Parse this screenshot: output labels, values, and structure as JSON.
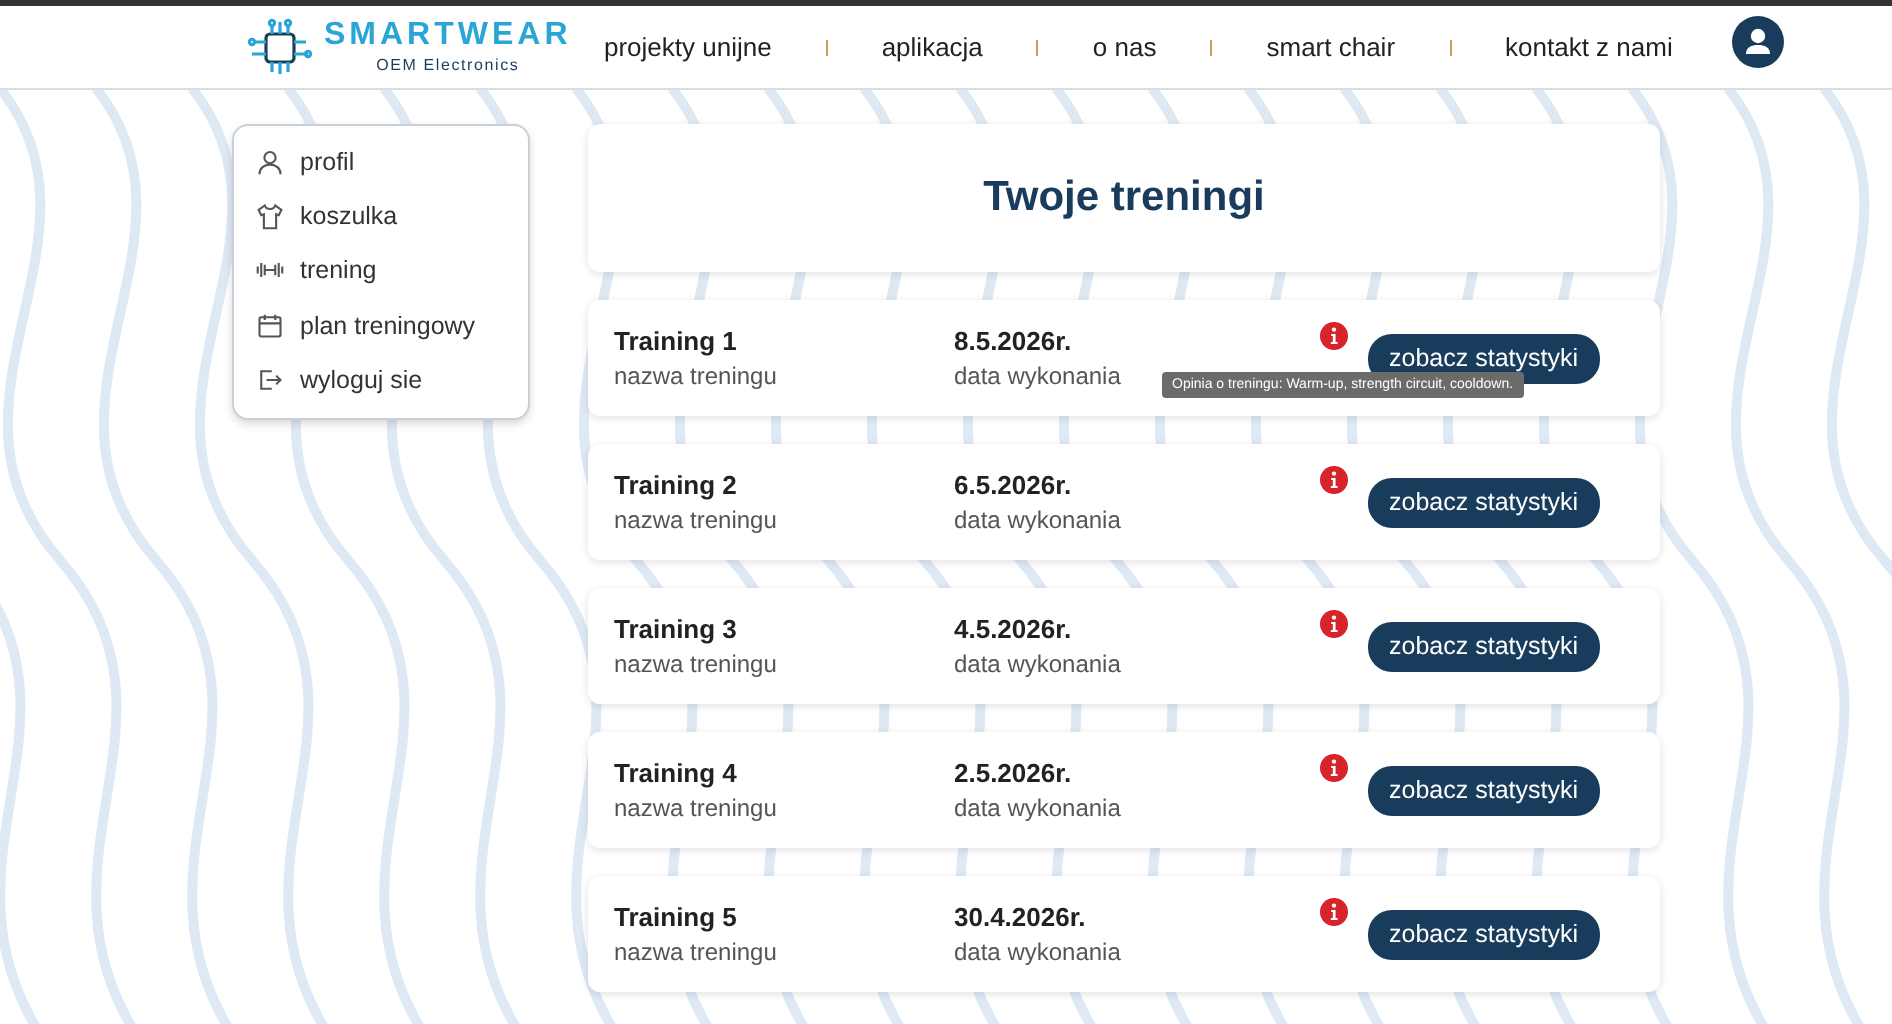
{
  "header": {
    "logo": {
      "name": "SMARTWEAR",
      "tagline": "OEM Electronics"
    },
    "nav": [
      {
        "label": "projekty unijne"
      },
      {
        "label": "aplikacja"
      },
      {
        "label": "o nas"
      },
      {
        "label": "smart chair"
      },
      {
        "label": "kontakt z nami"
      }
    ]
  },
  "sidebar": {
    "items": [
      {
        "label": "profil"
      },
      {
        "label": "koszulka"
      },
      {
        "label": "trening"
      },
      {
        "label": "plan treningowy"
      },
      {
        "label": "wyloguj sie"
      }
    ]
  },
  "page_title": "Twoje treningi",
  "trainings": [
    {
      "title": "Training 1",
      "subtitle": "nazwa treningu",
      "date": "8.5.2026r.",
      "date_label": "data wykonania",
      "button": "zobacz statystyki",
      "tooltip": "Opinia o treningu: Warm-up, strength circuit, cooldown."
    },
    {
      "title": "Training 2",
      "subtitle": "nazwa treningu",
      "date": "6.5.2026r.",
      "date_label": "data wykonania",
      "button": "zobacz statystyki"
    },
    {
      "title": "Training 3",
      "subtitle": "nazwa treningu",
      "date": "4.5.2026r.",
      "date_label": "data wykonania",
      "button": "zobacz statystyki"
    },
    {
      "title": "Training 4",
      "subtitle": "nazwa treningu",
      "date": "2.5.2026r.",
      "date_label": "data wykonania",
      "button": "zobacz statystyki"
    },
    {
      "title": "Training 5",
      "subtitle": "nazwa treningu",
      "date": "30.4.2026r.",
      "date_label": "data wykonania",
      "button": "zobacz statystyki"
    }
  ]
}
